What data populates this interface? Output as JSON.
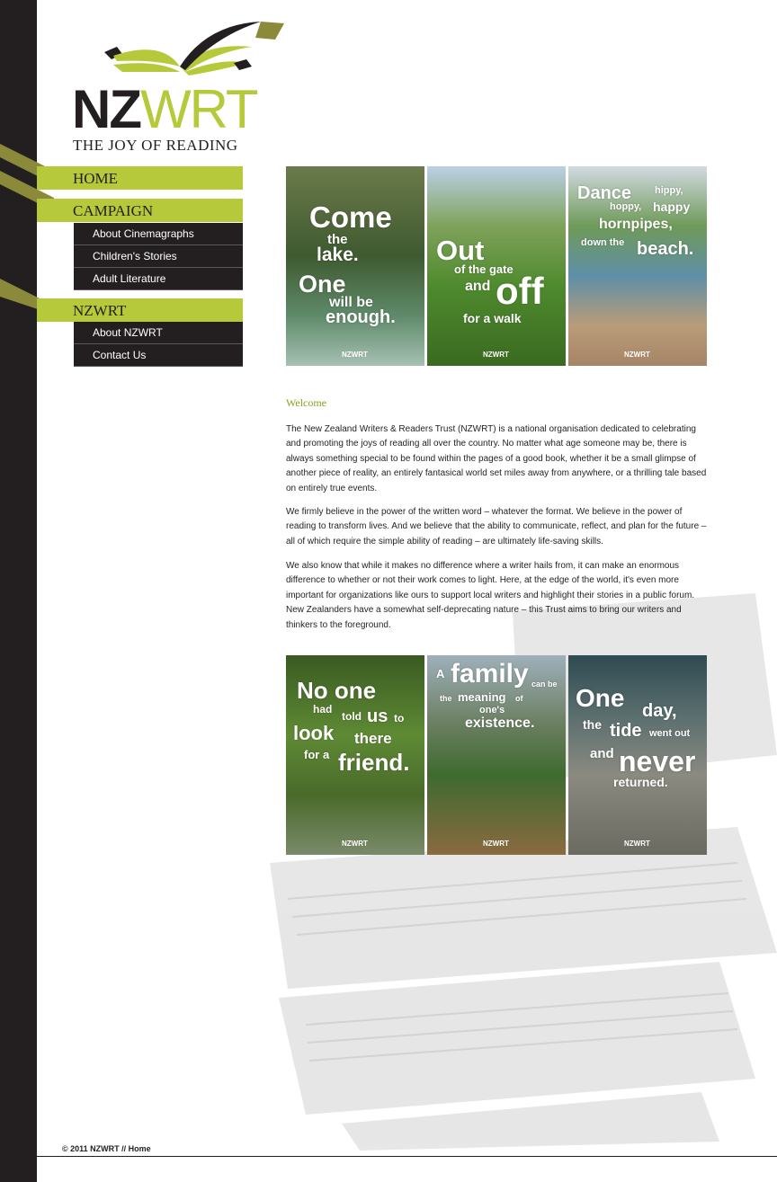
{
  "brand": {
    "logo_left": "NZ",
    "logo_right": "WRT",
    "tagline": "THE JOY OF READING",
    "accent": "#b5c93a",
    "dark": "#231f20"
  },
  "nav": {
    "home": "HOME",
    "campaign": "CAMPAIGN",
    "campaign_items": [
      "About Cinemagraphs",
      "Children's Stories",
      "Adult Literature"
    ],
    "nzwrt": "NZWRT",
    "nzwrt_items": [
      "About NZWRT",
      "Contact Us"
    ]
  },
  "posters_top": [
    {
      "lines": [
        "Come",
        "the",
        "lake.",
        "One",
        "will be",
        "enough."
      ],
      "badge": "NZWRT"
    },
    {
      "lines": [
        "Out",
        "of the gate",
        "and",
        "off",
        "for a walk"
      ],
      "badge": "NZWRT"
    },
    {
      "lines": [
        "Dance",
        "hippy,",
        "hoppy,",
        "happy",
        "hornpipes,",
        "down the",
        "beach."
      ],
      "badge": "NZWRT"
    }
  ],
  "posters_bottom": [
    {
      "lines": [
        "No one",
        "had",
        "told",
        "us",
        "to",
        "look",
        "there",
        "for a",
        "friend."
      ],
      "badge": "NZWRT"
    },
    {
      "lines": [
        "A",
        "family",
        "can be",
        "the",
        "meaning",
        "of",
        "one's",
        "existence."
      ],
      "badge": "NZWRT"
    },
    {
      "lines": [
        "One",
        "day,",
        "the",
        "tide",
        "went out",
        "and",
        "never",
        "returned."
      ],
      "badge": "NZWRT"
    }
  ],
  "content": {
    "welcome": "Welcome",
    "p1": "The New Zealand Writers & Readers Trust (NZWRT) is a national organisation dedicated to celebrating and promoting the joys of reading all over the country. No matter what age someone may be, there is always something special to be found within the pages of a good book, whether it be a small glimpse of another piece of reality, an entirely fantasical world set miles away from anywhere, or a thrilling tale based on entirely true events.",
    "p2": "We firmly believe in the power of the written word – whatever the format. We believe in the power of reading to transform lives. And we believe that the ability to communicate, reflect, and plan for the future – all of which require the simple ability of reading – are ultimately life-saving skills.",
    "p3": "We also know that while it makes no difference where a writer hails from, it can make an enormous difference to whether or not their work comes to light. Here, at the edge of the world, it's even more important for organizations like ours to support local writers and highlight their stories in a public forum. New Zealanders have a somewhat self-deprecating nature – this Trust aims to bring our writers and thinkers to the foreground."
  },
  "footer": {
    "text": "© 2011 NZWRT // Home"
  }
}
